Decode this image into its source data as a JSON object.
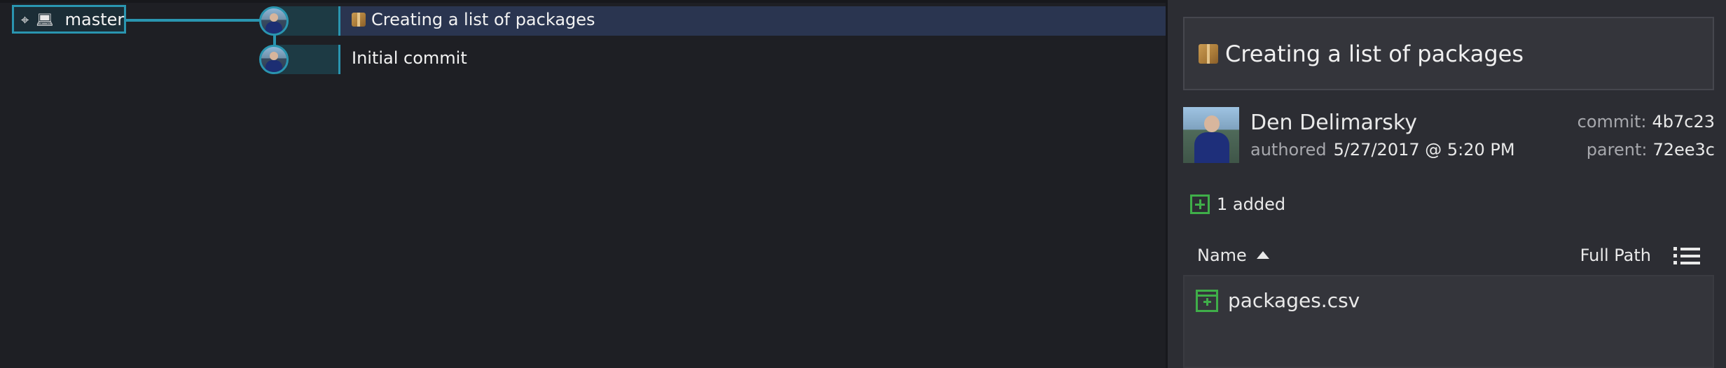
{
  "graph": {
    "branch": {
      "label": "master",
      "target_icon": "crosshair-icon",
      "computer_icon": "laptop-icon"
    },
    "commits": [
      {
        "message": "Creating a list of packages",
        "icon": "package-icon",
        "selected": true
      },
      {
        "message": "Initial commit",
        "selected": false
      }
    ]
  },
  "details": {
    "title": "Creating a list of packages",
    "author": "Den Delimarsky",
    "authored_label": "authored",
    "authored_value": "5/27/2017 @ 5:20 PM",
    "commit_label": "commit:",
    "commit_value": "4b7c23",
    "parent_label": "parent:",
    "parent_value": "72ee3c",
    "added_label": "1 added",
    "files_header": {
      "name": "Name",
      "path": "Full Path"
    },
    "files": [
      {
        "name": "packages.csv",
        "status": "added"
      }
    ]
  },
  "colors": {
    "accent": "#2a95b0",
    "added": "#3fae49",
    "selected_row": "#2a3550",
    "panel_bg": "#2c2d33"
  }
}
